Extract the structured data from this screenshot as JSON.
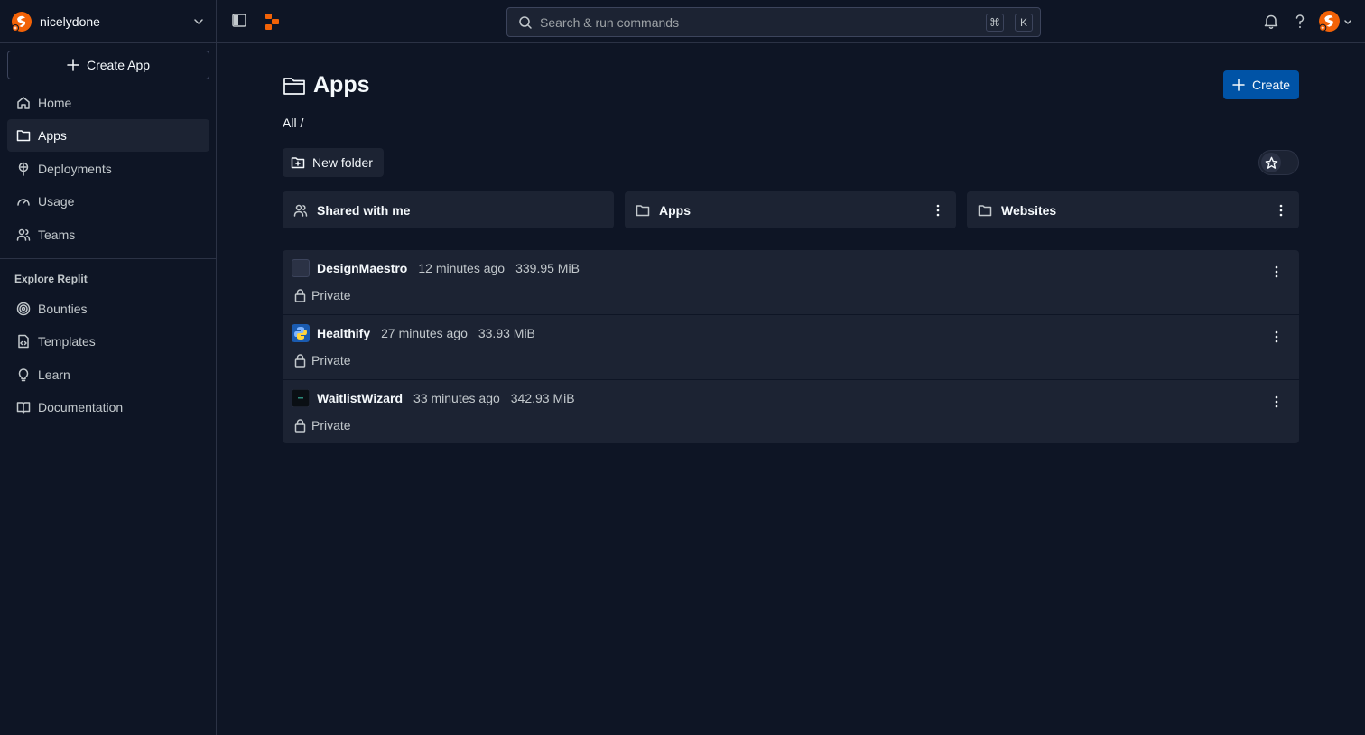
{
  "workspace": {
    "name": "nicelydone"
  },
  "sidebar": {
    "create_app_label": "Create App",
    "items": [
      {
        "label": "Home",
        "icon": "home-icon"
      },
      {
        "label": "Apps",
        "icon": "folder-icon",
        "active": true
      },
      {
        "label": "Deployments",
        "icon": "deployments-icon"
      },
      {
        "label": "Usage",
        "icon": "gauge-icon"
      },
      {
        "label": "Teams",
        "icon": "users-icon"
      }
    ],
    "explore_heading": "Explore Replit",
    "explore_items": [
      {
        "label": "Bounties",
        "icon": "bounty-icon"
      },
      {
        "label": "Templates",
        "icon": "template-icon"
      },
      {
        "label": "Learn",
        "icon": "lightbulb-icon"
      },
      {
        "label": "Documentation",
        "icon": "book-icon"
      }
    ]
  },
  "topbar": {
    "search_placeholder": "Search & run commands",
    "shortcut_keys": [
      "⌘",
      "K"
    ]
  },
  "main": {
    "title": "Apps",
    "create_label": "Create",
    "breadcrumb": "All /",
    "new_folder_label": "New folder",
    "folders": [
      {
        "label": "Shared with me",
        "icon": "users-icon"
      },
      {
        "label": "Apps",
        "icon": "folder-icon"
      },
      {
        "label": "Websites",
        "icon": "folder-icon"
      }
    ],
    "apps": [
      {
        "name": "DesignMaestro",
        "time": "12 minutes ago",
        "size": "339.95 MiB",
        "visibility": "Private"
      },
      {
        "name": "Healthify",
        "time": "27 minutes ago",
        "size": "33.93 MiB",
        "visibility": "Private"
      },
      {
        "name": "WaitlistWizard",
        "time": "33 minutes ago",
        "size": "342.93 MiB",
        "visibility": "Private"
      }
    ]
  },
  "colors": {
    "background": "#0e1525",
    "surface": "#1c2333",
    "border": "#2b3245",
    "primary_button": "#0053a6",
    "brand_orange": "#f26207"
  }
}
